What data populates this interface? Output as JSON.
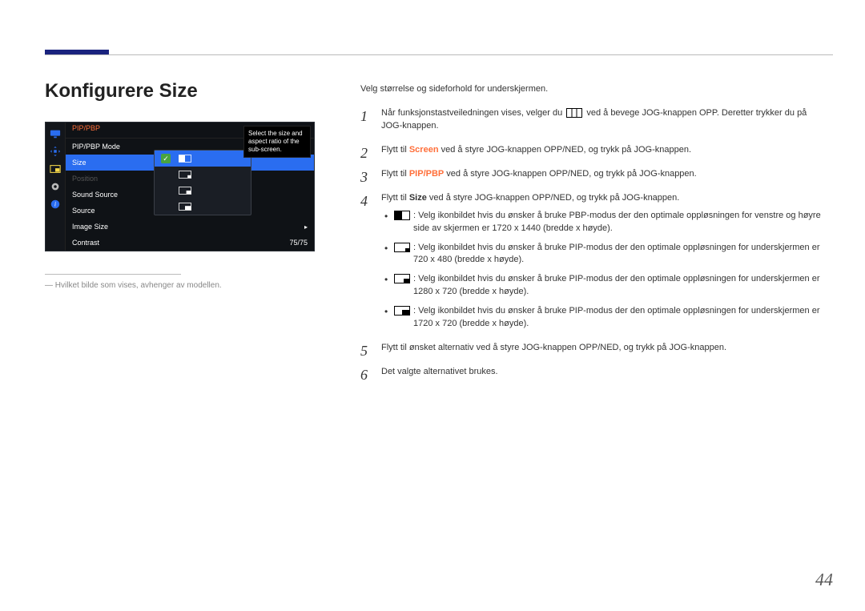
{
  "pageNumber": "44",
  "title": "Konfigurere Size",
  "osd": {
    "header": "PIP/PBP",
    "rows": {
      "mode": "PIP/PBP Mode",
      "size": "Size",
      "position": "Position",
      "soundSource": "Sound Source",
      "source": "Source",
      "imageSize": "Image Size",
      "contrast": "Contrast",
      "contrastVal": "75/75"
    },
    "tooltip": "Select the size and aspect ratio of the sub-screen."
  },
  "footnote": "Hvilket bilde som vises, avhenger av modellen.",
  "intro": "Velg størrelse og sideforhold for underskjermen.",
  "steps": {
    "s1a": "Når funksjonstastveiledningen vises, velger du ",
    "s1b": " ved å bevege JOG-knappen OPP. Deretter trykker du på JOG-knappen.",
    "s2a": "Flytt til ",
    "s2b": " ved å styre JOG-knappen OPP/NED, og trykk på JOG-knappen.",
    "s2_screen": "Screen",
    "s3_pip": "PIP/PBP",
    "s4_size": "Size",
    "s4b": " ved å styre JOG-knappen OPP/NED, og trykk på JOG-knappen.",
    "b1": ": Velg ikonbildet hvis du ønsker å bruke PBP-modus der den optimale oppløsningen for venstre og høyre side av skjermen er 1720 x 1440 (bredde x høyde).",
    "b2": ": Velg ikonbildet hvis du ønsker å bruke PIP-modus der den optimale oppløsningen for underskjermen er 720 x 480 (bredde x høyde).",
    "b3": ": Velg ikonbildet hvis du ønsker å bruke PIP-modus der den optimale oppløsningen for underskjermen er 1280 x 720 (bredde x høyde).",
    "b4": ": Velg ikonbildet hvis du ønsker å bruke PIP-modus der den optimale oppløsningen for underskjermen er 1720 x 720 (bredde x høyde).",
    "s5": "Flytt til ønsket alternativ ved å styre JOG-knappen OPP/NED, og trykk på JOG-knappen.",
    "s6": "Det valgte alternativet brukes."
  }
}
